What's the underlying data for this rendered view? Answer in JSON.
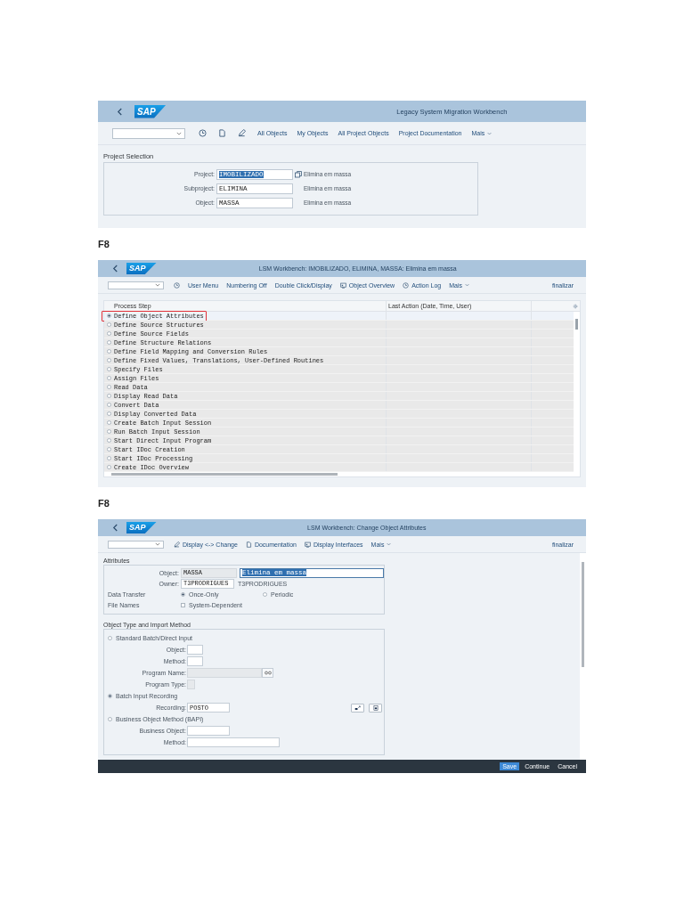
{
  "screen_1": {
    "logo": "SAP",
    "title": "Legacy System Migration Workbench",
    "toolbar": [
      {
        "kind": "link",
        "label": "All Objects"
      },
      {
        "kind": "link",
        "label": "My Objects"
      },
      {
        "kind": "link",
        "label": "All Project Objects"
      },
      {
        "kind": "link",
        "label": "Project Documentation"
      },
      {
        "kind": "menu",
        "label": "Mais"
      }
    ],
    "section_title": "Project Selection",
    "fields": [
      {
        "label": "Project:",
        "value": "IMOBILIZADO",
        "selected": true,
        "description": "Elimina em massa"
      },
      {
        "label": "Subproject:",
        "value": "ELIMINA",
        "selected": false,
        "description": "Elimina em massa"
      },
      {
        "label": "Object:",
        "value": "MASSA",
        "selected": false,
        "description": "Elimina em massa"
      }
    ]
  },
  "step_label_1": "F8",
  "screen_2": {
    "logo": "SAP",
    "title": "LSM Workbench: IMOBILIZADO, ELIMINA, MASSA: Elimina em massa",
    "toolbar": [
      {
        "kind": "link",
        "label": "User Menu"
      },
      {
        "kind": "link",
        "label": "Numbering Off"
      },
      {
        "kind": "link",
        "label": "Double Click/Display"
      },
      {
        "kind": "icon-link",
        "label": "Object Overview"
      },
      {
        "kind": "icon-link",
        "label": "Action Log"
      },
      {
        "kind": "menu",
        "label": "Mais"
      }
    ],
    "exit": "finalizar",
    "table": {
      "columns": [
        "Process Step",
        "Last Action (Date, Time, User)"
      ],
      "rows": [
        {
          "step": "Define Object Attributes",
          "selected": true,
          "outlined": true
        },
        {
          "step": "Define Source Structures",
          "selected": false,
          "outlined": false
        },
        {
          "step": "Define Source Fields",
          "selected": false,
          "outlined": false
        },
        {
          "step": "Define Structure Relations",
          "selected": false,
          "outlined": false
        },
        {
          "step": "Define Field Mapping and Conversion Rules",
          "selected": false,
          "outlined": false
        },
        {
          "step": "Define Fixed Values, Translations, User-Defined Routines",
          "selected": false,
          "outlined": false
        },
        {
          "step": "Specify Files",
          "selected": false,
          "outlined": false
        },
        {
          "step": "Assign Files",
          "selected": false,
          "outlined": false
        },
        {
          "step": "Read Data",
          "selected": false,
          "outlined": false
        },
        {
          "step": "Display Read Data",
          "selected": false,
          "outlined": false
        },
        {
          "step": "Convert Data",
          "selected": false,
          "outlined": false
        },
        {
          "step": "Display Converted Data",
          "selected": false,
          "outlined": false
        },
        {
          "step": "Create Batch Input Session",
          "selected": false,
          "outlined": false
        },
        {
          "step": "Run Batch Input Session",
          "selected": false,
          "outlined": false
        },
        {
          "step": "Start Direct Input Program",
          "selected": false,
          "outlined": false
        },
        {
          "step": "Start IDoc Creation",
          "selected": false,
          "outlined": false
        },
        {
          "step": "Start IDoc Processing",
          "selected": false,
          "outlined": false
        },
        {
          "step": "Create IDoc Overview",
          "selected": false,
          "outlined": false
        }
      ]
    }
  },
  "step_label_2": "F8",
  "screen_3": {
    "logo": "SAP",
    "title": "LSM Workbench: Change Object Attributes",
    "toolbar": [
      {
        "kind": "icon-link",
        "label": "Display <-> Change"
      },
      {
        "kind": "icon-link",
        "label": "Documentation"
      },
      {
        "kind": "icon-link",
        "label": "Display Interfaces"
      },
      {
        "kind": "menu",
        "label": "Mais"
      }
    ],
    "exit": "finalizar",
    "attributes": {
      "title": "Attributes",
      "object": {
        "label": "Object:",
        "value": "MASSA",
        "disabled": true,
        "description": "Elimina em massa",
        "description_selected": true
      },
      "owner": {
        "label": "Owner:",
        "value": "T3PRODRIGUES",
        "name": "T3PRODRIGUES"
      },
      "data_transfer": {
        "label": "Data Transfer",
        "options": [
          {
            "label": "Once-Only",
            "selected": true
          },
          {
            "label": "Periodic",
            "selected": false
          }
        ]
      },
      "file_names": {
        "label": "File Names",
        "checkbox": {
          "label": "System-Dependent",
          "checked": false
        }
      }
    },
    "import_method": {
      "title": "Object Type and Import Method",
      "items": [
        {
          "kind": "radio",
          "label": "Standard Batch/Direct Input",
          "selected": false
        },
        {
          "kind": "field",
          "label": "Object:",
          "disabled": false,
          "search_help": false,
          "tools": false
        },
        {
          "kind": "field",
          "label": "Method:",
          "disabled": false,
          "search_help": false,
          "tools": false
        },
        {
          "kind": "field",
          "label": "Program Name:",
          "disabled": true,
          "search_help": true,
          "tools": false
        },
        {
          "kind": "field",
          "label": "Program Type:",
          "disabled": true,
          "search_help": false,
          "tools": false
        },
        {
          "kind": "radio",
          "label": "Batch Input Recording",
          "selected": true
        },
        {
          "kind": "field",
          "label": "Recording:",
          "value": "POSTO",
          "disabled": false,
          "search_help": false,
          "tools": true
        },
        {
          "kind": "radio",
          "label": "Business Object Method  (BAPI)",
          "selected": false
        },
        {
          "kind": "field",
          "label": "Business Object:",
          "disabled": false,
          "search_help": false,
          "tools": false
        },
        {
          "kind": "field",
          "label": "Method:",
          "disabled": false,
          "search_help": false,
          "tools": false
        }
      ]
    },
    "footer": [
      {
        "label": "Save",
        "primary": true
      },
      {
        "label": "Continue",
        "primary": false
      },
      {
        "label": "Cancel",
        "primary": false
      }
    ]
  }
}
